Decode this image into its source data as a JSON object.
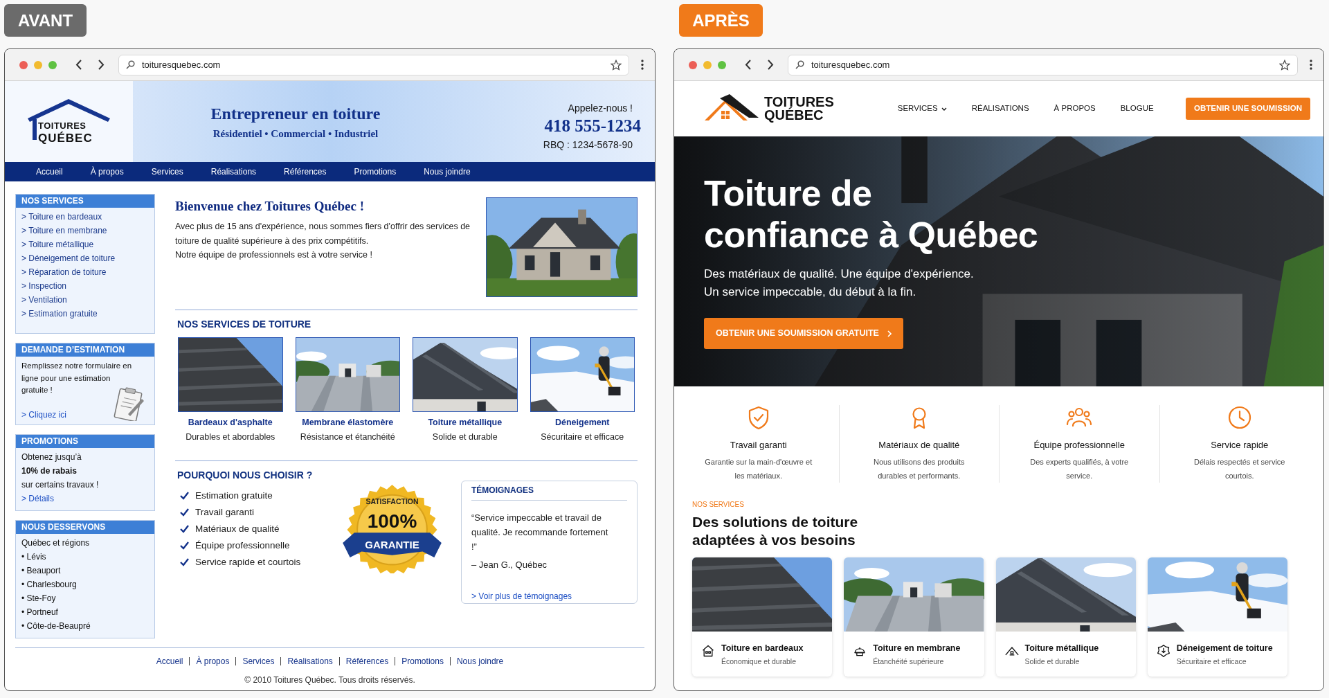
{
  "before": {
    "label": "AVANT",
    "url": "toituresquebec.com",
    "header": {
      "logo_top": "TOITURES",
      "logo_bottom": "QUÉBEC",
      "title": "Entrepreneur en toiture",
      "tagline": "Résidentiel • Commercial • Industriel",
      "call": "Appelez-nous !",
      "phone": "418 555-1234",
      "license": "RBQ : 1234-5678-90"
    },
    "nav": [
      "Accueil",
      "À propos",
      "Services",
      "Réalisations",
      "Références",
      "Promotions",
      "Nous joindre"
    ],
    "sidebar": {
      "services": {
        "title": "NOS SERVICES",
        "items": [
          "> Toiture en bardeaux",
          "> Toiture en membrane",
          "> Toiture métallique",
          "> Déneigement de toiture",
          "> Réparation de toiture",
          "> Inspection",
          "> Ventilation",
          "> Estimation gratuite"
        ]
      },
      "estimate": {
        "title": "DEMANDE D’ESTIMATION",
        "text": "Remplissez notre formulaire en ligne pour une estimation gratuite !",
        "link": "> Cliquez ici"
      },
      "promotions": {
        "title": "PROMOTIONS",
        "intro": "Obtenez jusqu’à",
        "offer": "10% de rabais",
        "condition": "sur certains travaux !",
        "link": "> Détails"
      },
      "areas": {
        "title": "NOUS DESSERVONS",
        "intro": "Québec et régions",
        "items": [
          "• Lévis",
          "• Beauport",
          "• Charlesbourg",
          "• Ste-Foy",
          "• Portneuf",
          "• Côte-de-Beaupré"
        ]
      }
    },
    "welcome": {
      "title": "Bienvenue chez Toitures Québec !",
      "paragraphs": [
        "Avec plus de 15 ans d'expérience, nous sommes fiers d'offrir des services de toiture de qualité supérieure à des prix compétitifs.",
        "Notre équipe de professionnels est à votre service !"
      ]
    },
    "services": {
      "title": "NOS SERVICES DE TOITURE",
      "cards": [
        {
          "name": "Bardeaux d'asphalte",
          "note": "Durables et abordables"
        },
        {
          "name": "Membrane élastomère",
          "note": "Résistance et étanchéité"
        },
        {
          "name": "Toiture métallique",
          "note": "Solide et durable"
        },
        {
          "name": "Déneigement",
          "note": "Sécuritaire et efficace"
        }
      ]
    },
    "why": {
      "title": "POURQUOI NOUS CHOISIR ?",
      "items": [
        "Estimation gratuite",
        "Travail garanti",
        "Matériaux de qualité",
        "Équipe professionnelle",
        "Service rapide et courtois"
      ],
      "seal": {
        "arc": "SATISFACTION",
        "figure": "100%",
        "ribbon": "GARANTIE"
      }
    },
    "testimonials": {
      "title": "TÉMOIGNAGES",
      "quote": "“Service impeccable et travail de qualité. Je recommande fortement !”",
      "author": "– Jean G., Québec",
      "link": "> Voir plus de témoignages"
    },
    "footer": {
      "links": [
        "Accueil",
        "À propos",
        "Services",
        "Réalisations",
        "Références",
        "Promotions",
        "Nous joindre"
      ],
      "copyright": "© 2010 Toitures Québec. Tous droits réservés."
    }
  },
  "after": {
    "label": "APRÈS",
    "url": "toituresquebec.com",
    "logo_top": "TOITURES",
    "logo_bottom": "QUÉBEC",
    "nav": [
      {
        "label": "SERVICES",
        "dropdown": true
      },
      {
        "label": "RÉALISATIONS",
        "dropdown": false
      },
      {
        "label": "À PROPOS",
        "dropdown": false
      },
      {
        "label": "BLOGUE",
        "dropdown": false
      }
    ],
    "cta": "OBTENIR UNE SOUMISSION",
    "hero": {
      "title_lines": [
        "Toiture de",
        "confiance à Québec"
      ],
      "subtitle_lines": [
        "Des matériaux de qualité. Une équipe d'expérience.",
        "Un service impeccable, du début à la fin."
      ],
      "button": "OBTENIR UNE SOUMISSION GRATUITE"
    },
    "features": [
      {
        "title": "Travail garanti",
        "text": "Garantie sur la main-d'œuvre et les matériaux."
      },
      {
        "title": "Matériaux de qualité",
        "text": "Nous utilisons des produits durables et performants."
      },
      {
        "title": "Équipe professionnelle",
        "text": "Des experts qualifiés, à votre service."
      },
      {
        "title": "Service rapide",
        "text": "Délais respectés et service courtois."
      }
    ],
    "services": {
      "eyebrow": "NOS SERVICES",
      "title": "Des solutions de toiture adaptées à vos besoins",
      "cards": [
        {
          "title": "Toiture en bardeaux",
          "text": "Économique et durable"
        },
        {
          "title": "Toiture en membrane",
          "text": "Étanchéité supérieure"
        },
        {
          "title": "Toiture métallique",
          "text": "Solide et durable"
        },
        {
          "title": "Déneigement de toiture",
          "text": "Sécuritaire et efficace"
        }
      ]
    }
  }
}
